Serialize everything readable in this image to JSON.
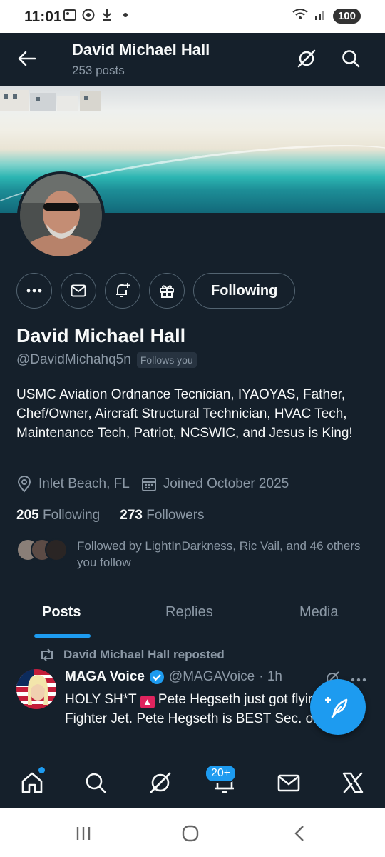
{
  "status_bar": {
    "time": "11:01",
    "left_icons": [
      "gallery-icon",
      "whatsapp-icon",
      "download-icon",
      "dot-icon"
    ],
    "right_icons": [
      "wifi-icon",
      "signal-icon"
    ],
    "battery": "100"
  },
  "top_bar": {
    "name": "David Michael Hall",
    "posts_count": "253 posts",
    "icons": [
      "back-arrow-icon",
      "grok-icon",
      "search-icon"
    ]
  },
  "profile": {
    "name": "David Michael Hall",
    "handle": "@DavidMichahq5n",
    "follows_you": "Follows you",
    "follow_button": "Following",
    "bio": "USMC Aviation Ordnance Tecnician, IYAOYAS, Father, Chef/Owner, Aircraft Structural Technician, HVAC Tech, Maintenance Tech, Patriot, NCSWIC, and Jesus is King!",
    "location": "Inlet Beach, FL",
    "joined": "Joined October 2025",
    "following_count": "205",
    "following_label": "Following",
    "followers_count": "273",
    "followers_label": "Followers",
    "followed_by": "Followed by LightInDarkness, Ric Vail, and 46 others you follow"
  },
  "tabs": [
    {
      "label": "Posts",
      "active": true
    },
    {
      "label": "Replies",
      "active": false
    },
    {
      "label": "Media",
      "active": false
    }
  ],
  "post": {
    "repost_label": "David Michael Hall reposted",
    "author": "MAGA Voice",
    "handle": "@MAGAVoice",
    "time": "· 1h",
    "text_part1": "HOLY SH*T",
    "text_part2": "Pete Hegseth just got flying in a Fighter Jet. Pete Hegseth is BEST Sec. of War"
  },
  "bottom_nav": {
    "items": [
      "home-icon",
      "search-icon",
      "grok-icon",
      "notifications-icon",
      "messages-icon",
      "x-icon"
    ],
    "notification_badge": "20+"
  },
  "colors": {
    "background": "#15202b",
    "accent": "#1d9bf0",
    "muted": "#8b98a5",
    "border": "#536471"
  }
}
